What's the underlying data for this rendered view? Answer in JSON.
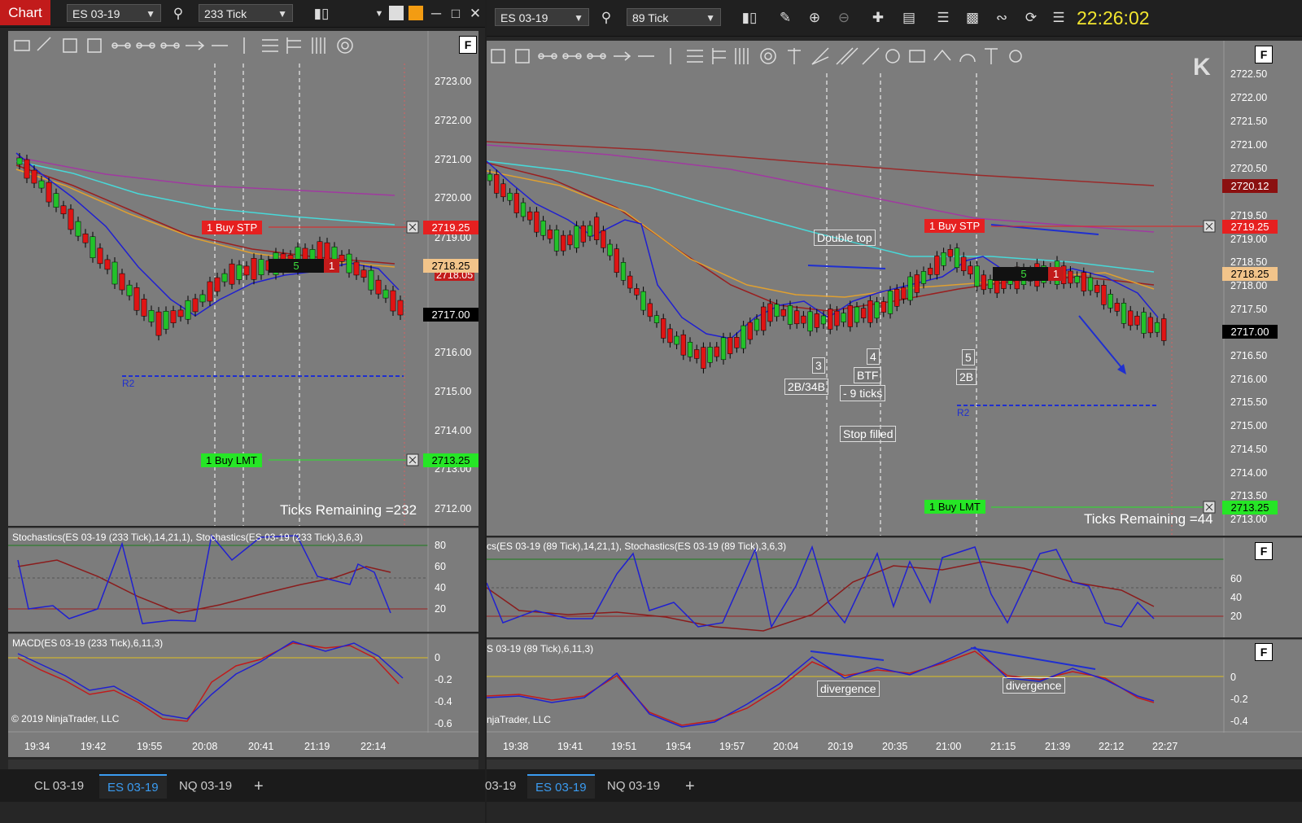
{
  "left_window": {
    "badge": "Chart",
    "instrument": "ES 03-19",
    "bar_type": "233 Tick",
    "price_axis": [
      "2723.00",
      "2722.00",
      "2721.00",
      "2720.00",
      "2719.00",
      "2718.00",
      "2717.00",
      "2716.00",
      "2715.00",
      "2714.00",
      "2713.00",
      "2712.00"
    ],
    "time_axis": [
      "19:34",
      "19:42",
      "19:55",
      "20:08",
      "20:41",
      "21:19",
      "22:14"
    ],
    "ticks_remaining": "Ticks Remaining =232",
    "stop_order": {
      "qty": "1",
      "label": "Buy STP",
      "price": "2719.25"
    },
    "limit_order": {
      "qty": "1",
      "label": "Buy LMT",
      "price": "2713.25"
    },
    "position": {
      "qty": "5",
      "side_qty": "1",
      "price": "2718.25"
    },
    "last_price": "2717.00",
    "mid_price": "2718.05",
    "pivot_label": "R2",
    "stoch_title": "Stochastics(ES 03-19 (233 Tick),14,21,1), Stochastics(ES 03-19 (233 Tick),3,6,3)",
    "stoch_axis": [
      "80",
      "60",
      "40",
      "20"
    ],
    "macd_title": "MACD(ES 03-19 (233 Tick),6,11,3)",
    "macd_axis": [
      "0",
      "-0.2",
      "-0.4",
      "-0.6"
    ],
    "copyright": "© 2019 NinjaTrader, LLC",
    "tabs": [
      "CL 03-19",
      "ES 03-19",
      "NQ 03-19"
    ],
    "active_tab": "ES 03-19"
  },
  "right_window": {
    "instrument": "ES 03-19",
    "bar_type": "89 Tick",
    "clock": "22:26:02",
    "price_axis": [
      "2722.50",
      "2722.00",
      "2721.50",
      "2721.00",
      "2720.50",
      "2720.12",
      "2719.50",
      "2719.25",
      "2719.00",
      "2718.50",
      "2718.25",
      "2718.00",
      "2717.50",
      "2717.00",
      "2716.50",
      "2716.00",
      "2715.50",
      "2715.00",
      "2714.50",
      "2714.00",
      "2713.50",
      "2713.25",
      "2713.00"
    ],
    "time_axis": [
      "19:38",
      "19:41",
      "19:51",
      "19:54",
      "19:57",
      "20:04",
      "20:19",
      "20:35",
      "21:00",
      "21:15",
      "21:39",
      "22:12",
      "22:27"
    ],
    "ticks_remaining": "Ticks Remaining =44",
    "stop_order": {
      "qty": "1",
      "label": "Buy STP",
      "price": "2719.25"
    },
    "limit_order": {
      "qty": "1",
      "label": "Buy LMT",
      "price": "2713.25"
    },
    "position": {
      "qty": "5",
      "side_qty": "1",
      "price": "2718.25"
    },
    "last_price": "2717.00",
    "upper_tag": "2720.12",
    "pivot_label": "R2",
    "annotations": {
      "double_top": "Double top",
      "n3": "3",
      "n4": "4",
      "n5": "5",
      "a3": "2B/34B",
      "a4": "BTF",
      "a5": "2B",
      "ticks": "- 9 ticks",
      "stop": "Stop filled",
      "div1": "divergence",
      "div2": "divergence"
    },
    "stoch_title": "cs(ES 03-19 (89 Tick),14,21,1), Stochastics(ES 03-19 (89 Tick),3,6,3)",
    "stoch_axis": [
      "60",
      "40",
      "20"
    ],
    "macd_title": "S 03-19 (89 Tick),6,11,3)",
    "macd_axis": [
      "0",
      "-0.2",
      "-0.4"
    ],
    "copyright": "njaTrader, LLC",
    "tabs": [
      "03-19",
      "ES 03-19",
      "NQ 03-19"
    ],
    "active_tab": "ES 03-19"
  },
  "colors": {
    "plot_bg": "#7c7c7c",
    "up_candle": "#22c22a",
    "down_candle": "#e01414",
    "stop_red": "#e62020",
    "limit_green": "#26e626",
    "clock_yellow": "#f2e52f",
    "active_tab_blue": "#3a9bf0"
  }
}
